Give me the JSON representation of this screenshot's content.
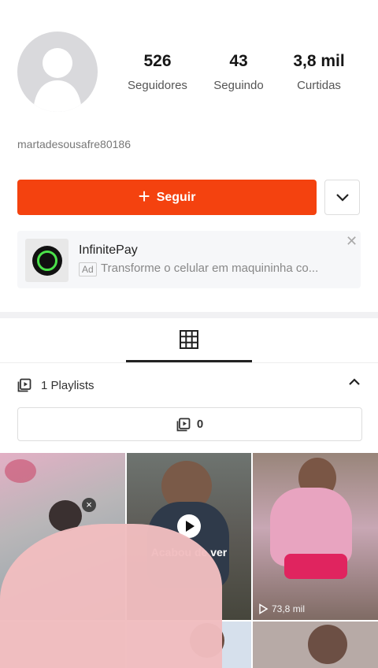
{
  "profile": {
    "followers_count": "526",
    "followers_label": "Seguidores",
    "following_count": "43",
    "following_label": "Seguindo",
    "likes_count": "3,8 mil",
    "likes_label": "Curtidas",
    "username": "martadesousafre80186"
  },
  "actions": {
    "follow_label": "Seguir",
    "follow_color": "#f4420f"
  },
  "ad": {
    "title": "InfinitePay",
    "tag": "Ad",
    "description": "Transforme o celular em maquininha co..."
  },
  "playlists": {
    "label": "1 Playlists",
    "count": "0"
  },
  "videos": [
    {
      "status": "",
      "views": ""
    },
    {
      "status": "Acabou de ver",
      "views": ""
    },
    {
      "status": "",
      "views": "73,8 mil"
    }
  ]
}
